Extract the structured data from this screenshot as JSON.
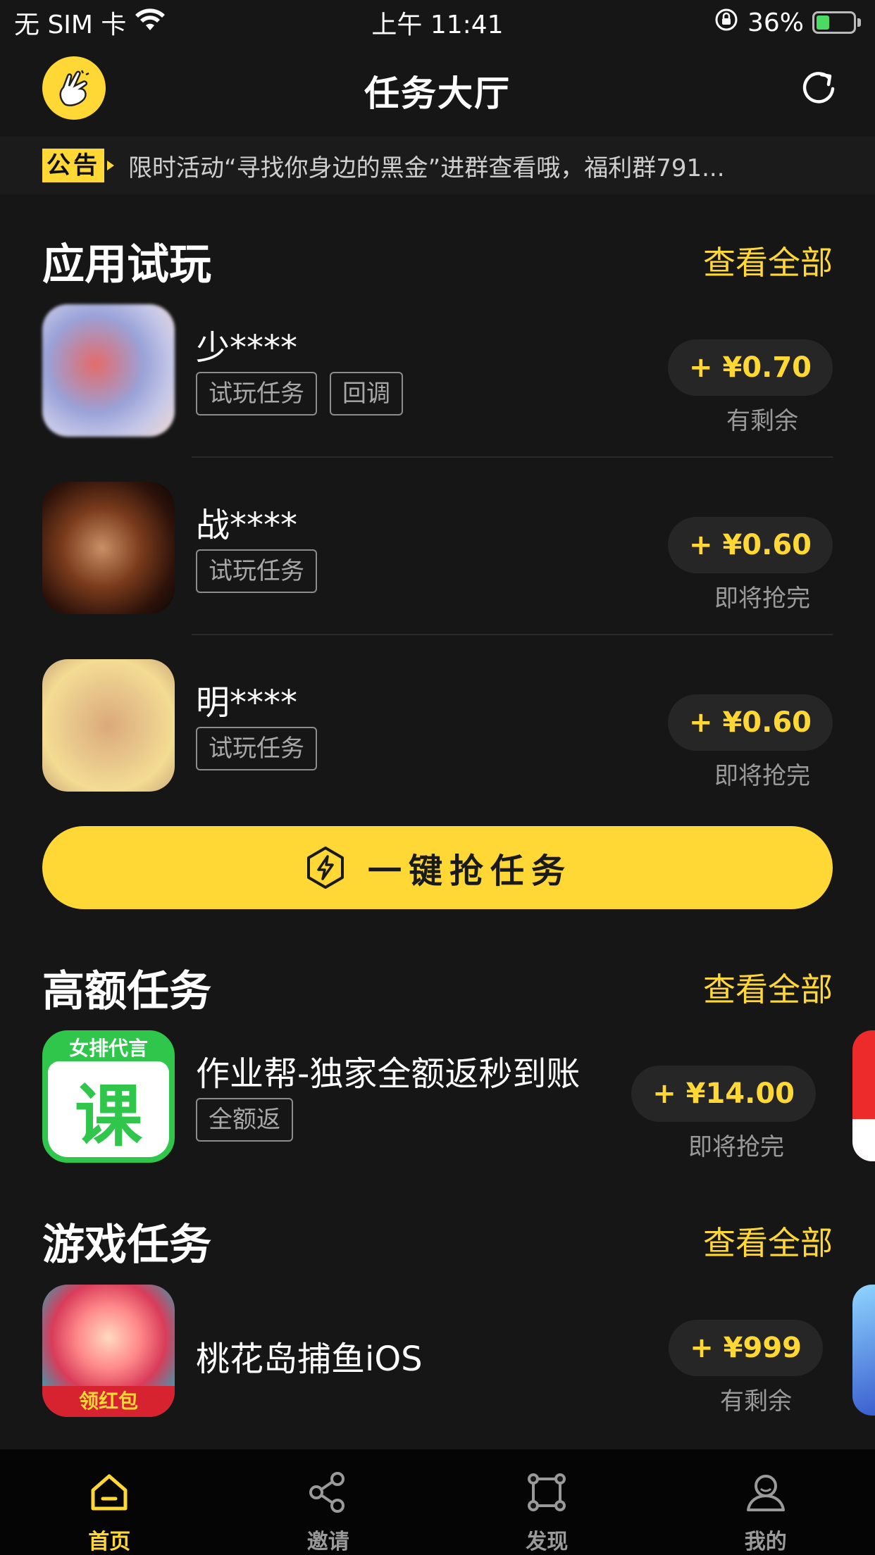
{
  "status_bar": {
    "carrier": "无 SIM 卡",
    "time": "上午 11:41",
    "battery": "36%"
  },
  "header": {
    "title": "任务大厅"
  },
  "notice": {
    "badge": "公告",
    "text": "限时活动“寻找你身边的黑金”进群查看哦，福利群791..."
  },
  "trial_section": {
    "title": "应用试玩",
    "view_all": "查看全部",
    "items": [
      {
        "name": "少****",
        "tags": [
          "试玩任务",
          "回调"
        ],
        "price": "+ ¥0.70",
        "status": "有剩余"
      },
      {
        "name": "战****",
        "tags": [
          "试玩任务"
        ],
        "price": "+ ¥0.60",
        "status": "即将抢完"
      },
      {
        "name": "明****",
        "tags": [
          "试玩任务"
        ],
        "price": "+ ¥0.60",
        "status": "即将抢完"
      }
    ]
  },
  "grab_button": {
    "label": "一键抢任务"
  },
  "high_section": {
    "title": "高额任务",
    "view_all": "查看全部",
    "items": [
      {
        "name": "作业帮-独家全额返秒到账",
        "icon_top": "女排代言",
        "icon_char": "课",
        "tags": [
          "全额返"
        ],
        "price": "+ ¥14.00",
        "status": "即将抢完"
      }
    ]
  },
  "game_section": {
    "title": "游戏任务",
    "view_all": "查看全部",
    "items": [
      {
        "name": "桃花岛捕鱼iOS",
        "icon_label": "领红包",
        "price": "+ ¥999",
        "status": "有剩余"
      }
    ]
  },
  "tab_bar": {
    "tabs": [
      {
        "label": "首页",
        "icon": "home-icon",
        "active": true
      },
      {
        "label": "邀请",
        "icon": "share-icon",
        "active": false
      },
      {
        "label": "发现",
        "icon": "discover-icon",
        "active": false
      },
      {
        "label": "我的",
        "icon": "profile-icon",
        "active": false
      }
    ]
  },
  "colors": {
    "accent": "#ffd835",
    "background": "#161616",
    "tag_border": "#8c8c8c"
  }
}
